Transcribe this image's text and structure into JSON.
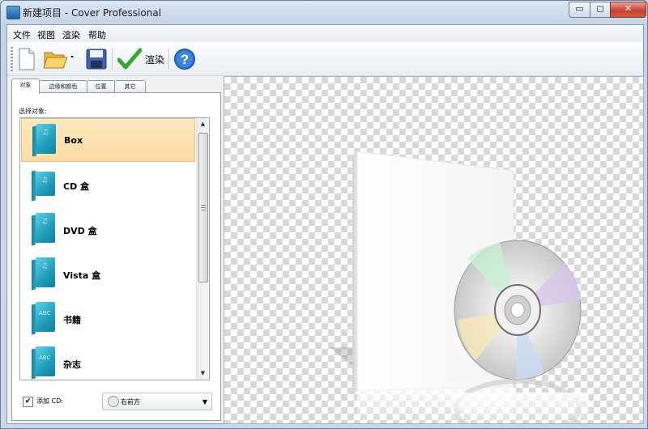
{
  "window": {
    "title": "新建项目 - Cover Professional",
    "minimize": "▭",
    "maximize": "◻",
    "close": "✕"
  },
  "menu": [
    "文件",
    "视图",
    "渲染",
    "帮助"
  ],
  "toolbar": {
    "render_label": "渲染"
  },
  "tabs": [
    "对象",
    "边缘和颜色",
    "位置",
    "其它"
  ],
  "panel": {
    "select_label": "选择对象:",
    "items": [
      {
        "label": "Box",
        "selected": true,
        "icon": "box-icon"
      },
      {
        "label": "CD 盒",
        "selected": false,
        "icon": "cd-case-icon"
      },
      {
        "label": "DVD 盒",
        "selected": false,
        "icon": "dvd-case-icon"
      },
      {
        "label": "Vista 盒",
        "selected": false,
        "icon": "vista-case-icon"
      },
      {
        "label": "书籍",
        "selected": false,
        "icon": "book-icon"
      },
      {
        "label": "杂志",
        "selected": false,
        "icon": "magazine-icon"
      }
    ],
    "add_cd_label": "添加 CD:",
    "add_cd_checked": true,
    "cd_position": "右前方"
  },
  "colors": {
    "selection": "#fbdca4",
    "item_cover": "#1f9cba",
    "title_bar": "#c4d4e6"
  }
}
